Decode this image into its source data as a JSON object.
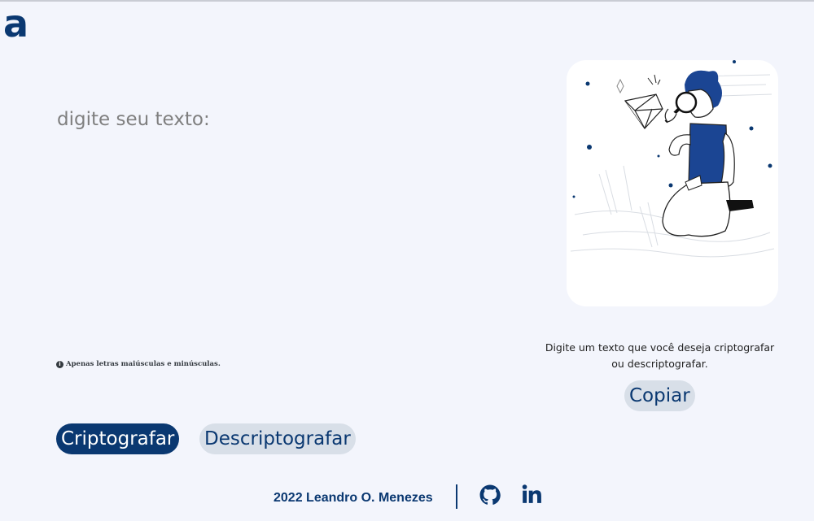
{
  "logo": {
    "text": "a"
  },
  "input": {
    "placeholder": "digite seu texto:",
    "value": ""
  },
  "hint": {
    "text": "Apenas letras maiúsculas e minúsculas."
  },
  "buttons": {
    "encrypt": "Criptografar",
    "decrypt": "Descriptografar",
    "copy": "Copiar"
  },
  "output": {
    "message": "Digite um texto que você deseja criptografar ou descriptografar.",
    "illustration": "person-with-magnifying-glass-diamond"
  },
  "footer": {
    "text": "2022 Leandro O. Menezes",
    "icons": [
      "github-icon",
      "linkedin-icon"
    ]
  },
  "colors": {
    "brand": "#0a3871",
    "background": "#f3f5fc",
    "secondary_button": "#d8dfe8"
  }
}
